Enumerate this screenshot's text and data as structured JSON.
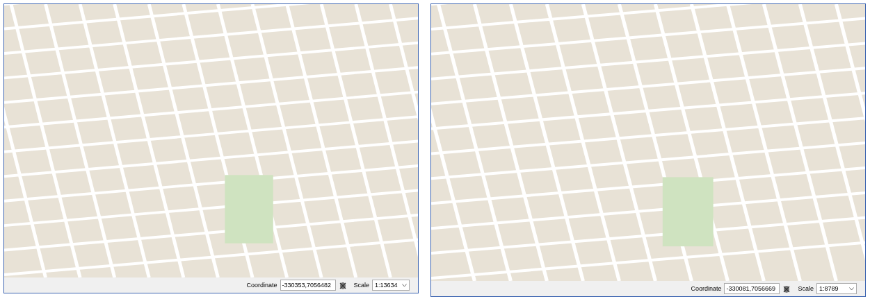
{
  "panels": [
    {
      "status_bar": {
        "coordinate_label": "Coordinate",
        "coordinate": "-330353,7056482",
        "scale_label": "Scale",
        "scale": "1:13634"
      }
    },
    {
      "status_bar": {
        "coordinate_label": "Coordinate",
        "coordinate": "-330081,7056669",
        "scale_label": "Scale",
        "scale": "1:8789"
      }
    }
  ]
}
